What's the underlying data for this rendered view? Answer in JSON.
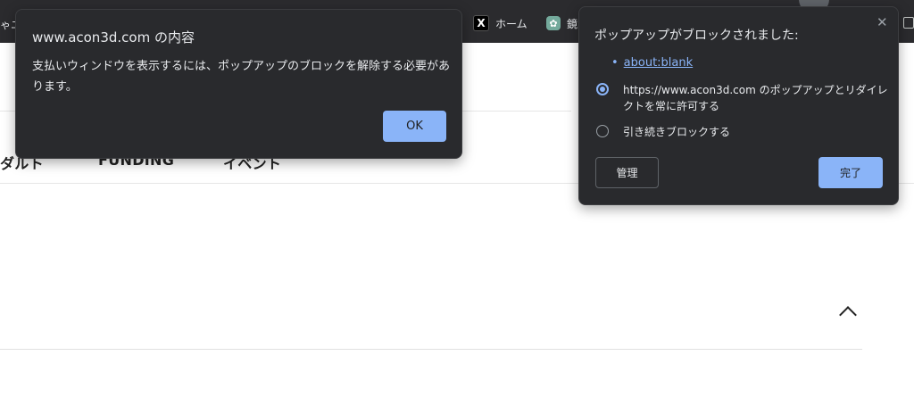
{
  "bookmarks_bar": {
    "left_fragment": "ゃニ",
    "items": [
      {
        "icon": "x-logo-icon",
        "glyph": "X",
        "label": "ホーム"
      },
      {
        "icon": "chatgpt-icon",
        "glyph": "✿",
        "label": "鏡"
      }
    ]
  },
  "page": {
    "nav_items": [
      "ダルト",
      "FUNDING",
      "イベント"
    ]
  },
  "alert": {
    "title": "www.acon3d.com の内容",
    "message": "支払いウィンドウを表示するには、ポップアップのブロックを解除する必要があります。",
    "ok_label": "OK"
  },
  "popup_blocked": {
    "title": "ポップアップがブロックされました:",
    "close_glyph": "✕",
    "blocked_links": [
      "about:blank"
    ],
    "options": [
      {
        "label": "https://www.acon3d.com のポップアップとリダイレクトを常に許可する",
        "selected": true
      },
      {
        "label": "引き続きブロックする",
        "selected": false
      }
    ],
    "manage_label": "管理",
    "done_label": "完了"
  },
  "colors": {
    "chrome_dark": "#2b2b2e",
    "dialog_bg": "#292a2d",
    "accent": "#8ab4f8"
  }
}
